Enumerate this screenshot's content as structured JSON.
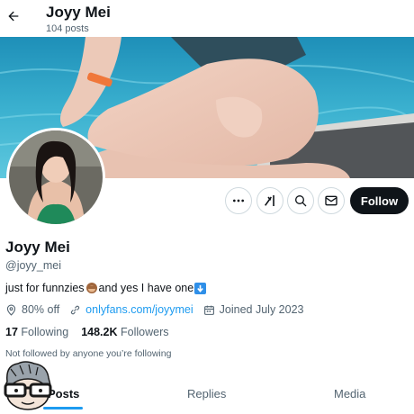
{
  "header": {
    "title": "Joyy Mei",
    "post_count": "104 posts"
  },
  "profile": {
    "display_name": "Joyy Mei",
    "handle": "@joyy_mei",
    "bio_part1": "just for funnzies",
    "bio_part2": "and yes I have one",
    "location": "80% off",
    "website": "onlyfans.com/joyymei",
    "joined": "Joined July 2023",
    "following_count": "17",
    "following_label": "Following",
    "followers_count": "148.2K",
    "followers_label": "Followers",
    "followed_by_text": "Not followed by anyone you’re following"
  },
  "actions": {
    "follow_label": "Follow"
  },
  "tabs": [
    {
      "label": "Posts",
      "active": true
    },
    {
      "label": "Replies",
      "active": false
    },
    {
      "label": "Media",
      "active": false
    }
  ],
  "colors": {
    "accent": "#1d9bf0",
    "follow_button": "#0f1419",
    "muted_text": "#536471"
  },
  "icons": {
    "back": "back-arrow-icon",
    "more": "more-icon",
    "grok": "grok-icon",
    "search": "search-icon",
    "message": "message-icon",
    "location": "location-icon",
    "link": "link-icon",
    "calendar": "calendar-icon"
  }
}
